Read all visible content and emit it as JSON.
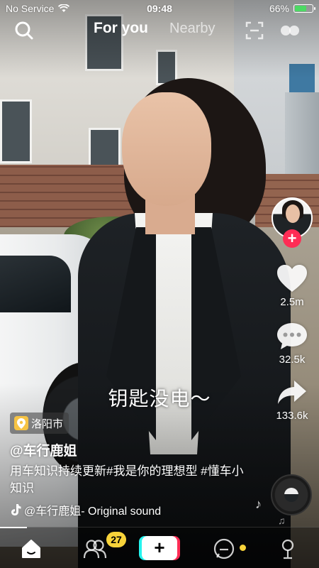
{
  "status_bar": {
    "carrier": "No Service",
    "time": "09:48",
    "battery_text": "66%",
    "battery_level": 0.66,
    "battery_color": "#4cd964"
  },
  "top_nav": {
    "tabs": [
      {
        "label": "For you",
        "active": true
      },
      {
        "label": "Nearby",
        "active": false
      }
    ],
    "icons": [
      "search-icon",
      "scan-icon",
      "dual-dots-icon"
    ]
  },
  "video": {
    "subtitle": "钥匙没电～",
    "location": "洛阳市",
    "username": "@车行鹿姐",
    "description": "用车知识持续更新#我是你的理想型 #懂车小知识",
    "music": "@车行鹿姐- Original sound"
  },
  "rail": {
    "like_count": "2.5m",
    "comment_count": "32.5k",
    "share_count": "133.6k",
    "follow_symbol": "+",
    "accent_color": "#fe2c55"
  },
  "tab_bar": {
    "badge_count": "27",
    "create_symbol": "+",
    "icons": [
      "home-icon",
      "friends-icon",
      "create-icon",
      "inbox-icon",
      "profile-icon"
    ],
    "badge_color": "#f8d33a"
  }
}
